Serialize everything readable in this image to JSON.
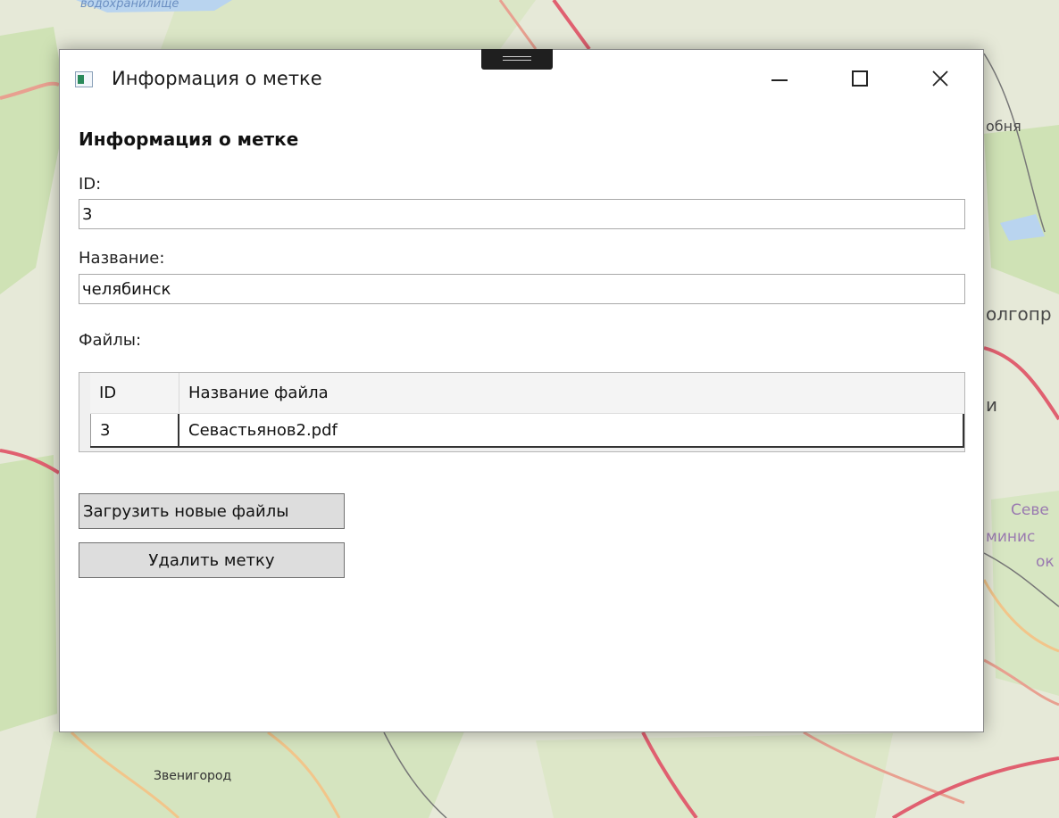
{
  "map": {
    "labels": {
      "reservoir": "водохранилище",
      "town_top_right": "обня",
      "town_right": "олгопр",
      "letter_right": "и",
      "district_right_1": "Севе",
      "district_right_2": "миниc",
      "district_right_3": "ок",
      "town_bottom": "Звенигород"
    }
  },
  "window": {
    "title": "Информация о метке",
    "controls": {
      "close_symbol": "✕"
    }
  },
  "form": {
    "heading": "Информация о метке",
    "id_label": "ID:",
    "id_value": "3",
    "name_label": "Название:",
    "name_value": "челябинск",
    "files_label": "Файлы:"
  },
  "files_table": {
    "columns": [
      "ID",
      "Название файла"
    ],
    "rows": [
      {
        "id": "3",
        "file_name": "Севастьянов2.pdf"
      }
    ]
  },
  "actions": {
    "upload_label": "Загрузить новые файлы",
    "delete_label": "Удалить метку"
  },
  "colors": {
    "window_bg": "#ffffff",
    "button_bg": "#dddddd",
    "map_bg": "#e8eadc"
  }
}
